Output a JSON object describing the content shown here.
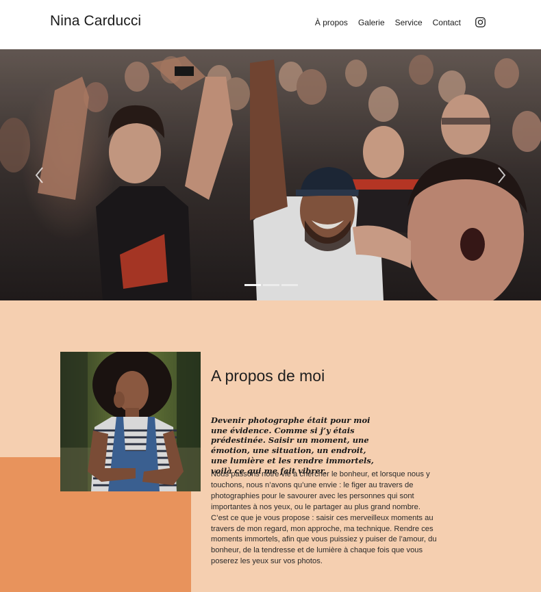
{
  "header": {
    "brand": "Nina Carducci",
    "nav": [
      {
        "label": "À propos"
      },
      {
        "label": "Galerie"
      },
      {
        "label": "Service"
      },
      {
        "label": "Contact"
      }
    ],
    "social_icon": "instagram-icon"
  },
  "carousel": {
    "slide_count": 3,
    "active_index": 0,
    "prev_icon": "chevron-left-icon",
    "next_icon": "chevron-right-icon"
  },
  "about": {
    "title": "A propos de moi",
    "tagline": "Devenir photographe était pour moi une évidence. Comme si j’y étais prédestinée. Saisir un moment, une émotion, une situation, un endroit, une lumière et les rendre immortels, voilà ce qui me fait vibrer.",
    "bio": "Nous passons notre vie à chercher le bonheur, et lorsque nous y touchons, nous n’avons qu’une envie : le figer au travers de photographies pour le savourer avec les personnes qui sont importantes à nos yeux, ou le partager au plus grand nombre. C’est ce que je vous propose : saisir ces merveilleux moments au travers de mon regard, mon approche, ma technique. Rendre ces moments immortels, afin que vous puissiez y puiser de l’amour, du bonheur, de la tendresse et de lumière à chaque fois que vous poserez les yeux sur vos photos."
  },
  "colors": {
    "section_bg": "#f5cfb0",
    "accent_block": "#e8935c",
    "header_bg": "#ffffff"
  }
}
